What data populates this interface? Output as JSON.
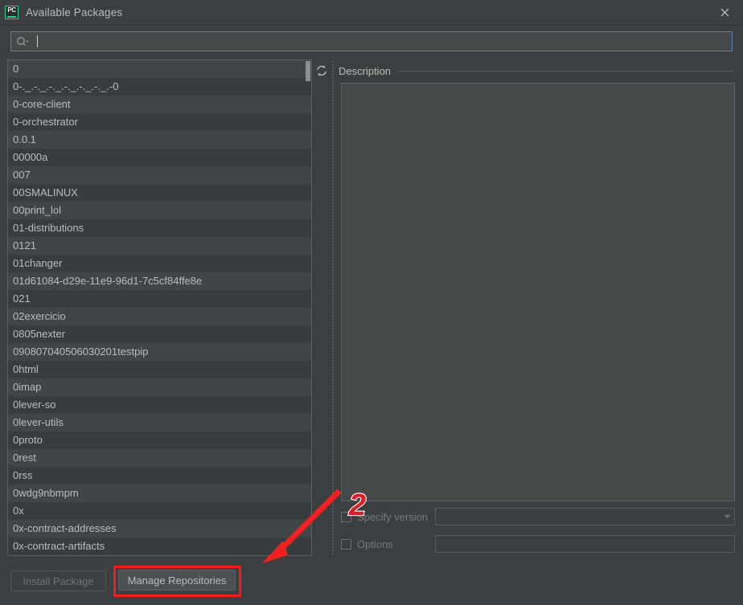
{
  "window": {
    "title": "Available Packages",
    "app_icon": "pycharm-icon",
    "app_icon_text": "PC",
    "close_icon": "close-icon",
    "accent_green": "#21d789",
    "background": "#3c3f41"
  },
  "search": {
    "icon": "search-icon",
    "value": "",
    "placeholder": ""
  },
  "package_list": {
    "refresh_icon": "refresh-icon",
    "items": [
      "0",
      "0-._.-._.-._.-._.-._.-._.-0",
      "0-core-client",
      "0-orchestrator",
      "0.0.1",
      "00000a",
      "007",
      "00SMALINUX",
      "00print_lol",
      "01-distributions",
      "0121",
      "01changer",
      "01d61084-d29e-11e9-96d1-7c5cf84ffe8e",
      "021",
      "02exercicio",
      "0805nexter",
      "090807040506030201testpip",
      "0html",
      "0imap",
      "0lever-so",
      "0lever-utils",
      "0proto",
      "0rest",
      "0rss",
      "0wdg9nbmpm",
      "0x",
      "0x-contract-addresses",
      "0x-contract-artifacts"
    ]
  },
  "description": {
    "title": "Description",
    "body": ""
  },
  "form": {
    "specify_version": {
      "label": "Specify version",
      "checked": false,
      "value": "",
      "dropdown_icon": "chevron-down-icon"
    },
    "options": {
      "label": "Options",
      "checked": false,
      "value": ""
    }
  },
  "buttons": {
    "install": {
      "label": "Install Package",
      "enabled": false
    },
    "manage": {
      "label": "Manage Repositories",
      "enabled": true
    }
  },
  "annotations": {
    "step_number": "2",
    "highlight_color": "#f51b1b",
    "arrow": "red-arrow-pointing-to-manage-repositories"
  }
}
